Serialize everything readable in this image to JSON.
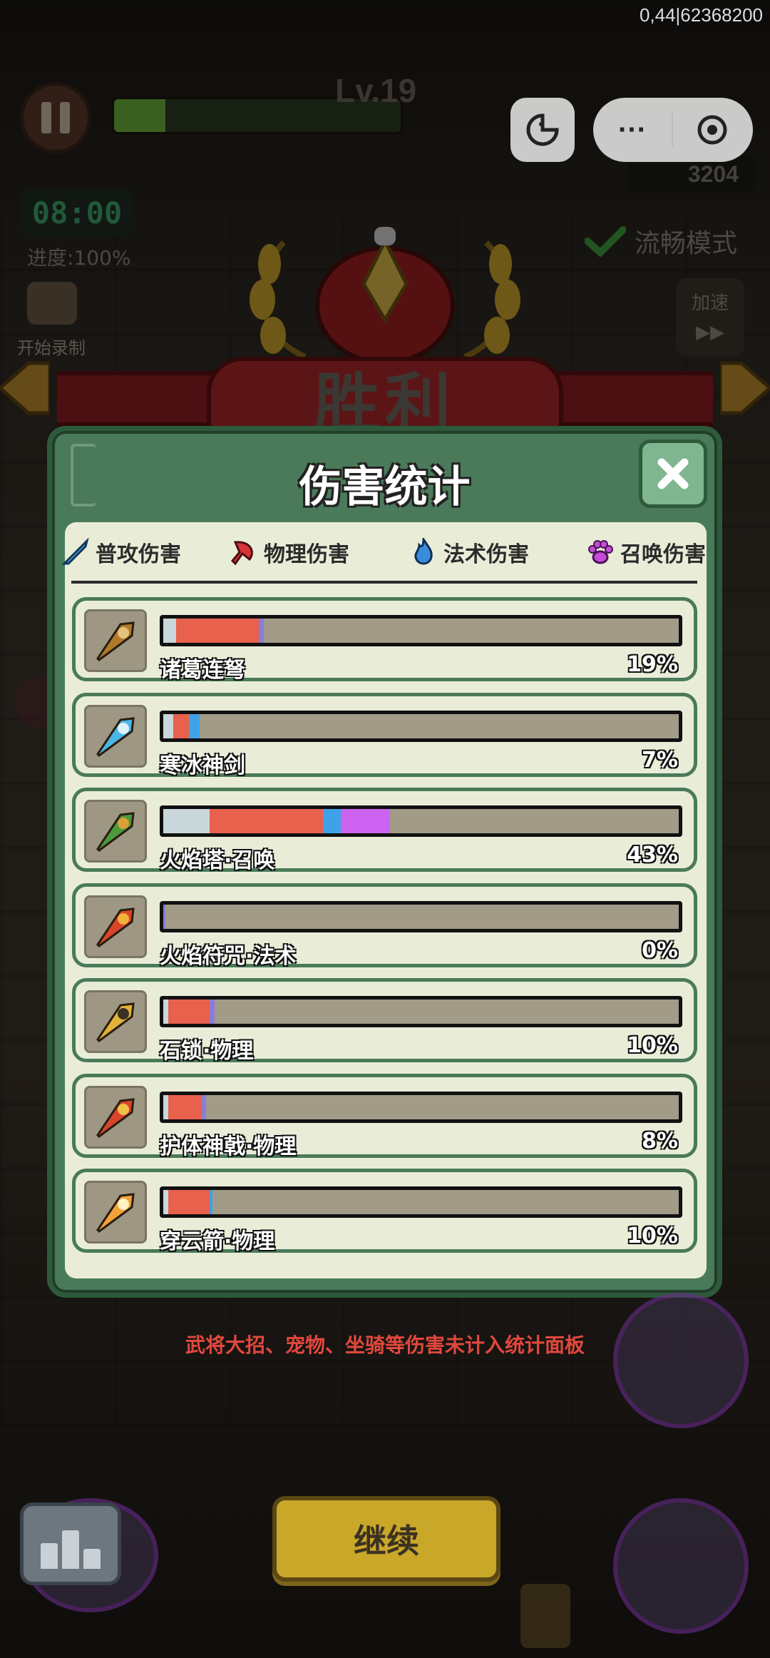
{
  "system": {
    "readout": "0,44|62368200"
  },
  "hud": {
    "level": "Lv.19",
    "xp_fraction": 0.18,
    "timer": "08:00",
    "progress": "进度:100%",
    "record_label": "开始录制",
    "score": "3204",
    "smooth_mode": "流畅模式",
    "speed_label": "加速",
    "speed_arrows": "▶▶"
  },
  "miniprogram": {
    "more": "···"
  },
  "victory": {
    "title": "胜利"
  },
  "modal": {
    "title": "伤害统计",
    "close_icon": "close-icon",
    "legend": [
      {
        "label": "普攻伤害",
        "icon": "sword-icon",
        "color": "#4aa0e0"
      },
      {
        "label": "物理伤害",
        "icon": "axe-icon",
        "color": "#d9343b"
      },
      {
        "label": "法术伤害",
        "icon": "flame-icon",
        "color": "#3b8bdc"
      },
      {
        "label": "召唤伤害",
        "icon": "paw-icon",
        "color": "#c64bd8"
      }
    ],
    "rows": [
      {
        "name": "诸葛连弩",
        "percent": "19%",
        "icon": "crossbow-icon",
        "segments": [
          {
            "color": "#c9d6da",
            "fraction": 0.025
          },
          {
            "color": "#e8614d",
            "fraction": 0.16
          },
          {
            "color": "#8a7cdc",
            "fraction": 0.01
          }
        ]
      },
      {
        "name": "寒冰神剑",
        "percent": "7%",
        "icon": "ice-sword-icon",
        "segments": [
          {
            "color": "#c9d6da",
            "fraction": 0.02
          },
          {
            "color": "#e8614d",
            "fraction": 0.03
          },
          {
            "color": "#3fa2e8",
            "fraction": 0.02
          }
        ]
      },
      {
        "name": "火焰塔·召唤",
        "percent": "43%",
        "icon": "fire-tower-icon",
        "segments": [
          {
            "color": "#c9d6da",
            "fraction": 0.09
          },
          {
            "color": "#e8614d",
            "fraction": 0.22
          },
          {
            "color": "#3fa2e8",
            "fraction": 0.035
          },
          {
            "color": "#cc63f0",
            "fraction": 0.095
          }
        ]
      },
      {
        "name": "火焰符咒·法术",
        "percent": "0%",
        "icon": "fire-scroll-icon",
        "segments": [
          {
            "color": "#8a7cdc",
            "fraction": 0.004
          }
        ]
      },
      {
        "name": "石锁·物理",
        "percent": "10%",
        "icon": "stone-lock-icon",
        "segments": [
          {
            "color": "#c9d6da",
            "fraction": 0.01
          },
          {
            "color": "#e8614d",
            "fraction": 0.08
          },
          {
            "color": "#8a7cdc",
            "fraction": 0.01
          }
        ]
      },
      {
        "name": "护体神戟·物理",
        "percent": "8%",
        "icon": "halberd-icon",
        "segments": [
          {
            "color": "#c9d6da",
            "fraction": 0.01
          },
          {
            "color": "#e8614d",
            "fraction": 0.065
          },
          {
            "color": "#8a7cdc",
            "fraction": 0.008
          }
        ]
      },
      {
        "name": "穿云箭·物理",
        "percent": "10%",
        "icon": "arrow-volley-icon",
        "segments": [
          {
            "color": "#c9d6da",
            "fraction": 0.01
          },
          {
            "color": "#e8614d",
            "fraction": 0.08
          },
          {
            "color": "#3fa2e8",
            "fraction": 0.006
          }
        ]
      }
    ]
  },
  "footnote": "武将大招、宠物、坐骑等伤害未计入统计面板",
  "actions": {
    "continue": "继续"
  }
}
